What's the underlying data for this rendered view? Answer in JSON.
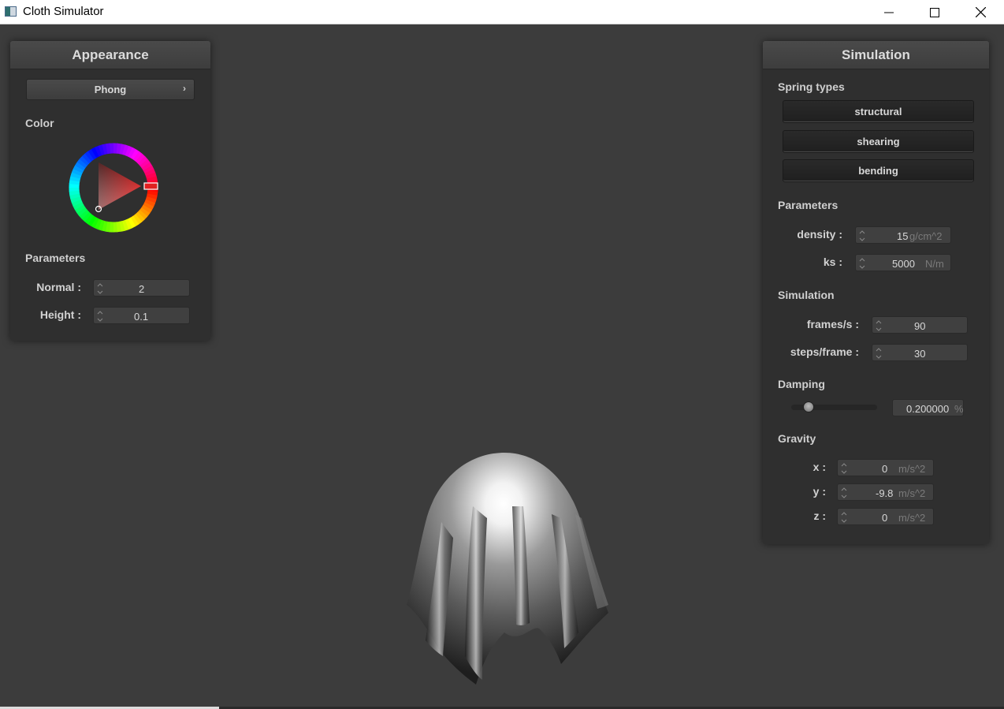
{
  "window": {
    "title": "Cloth Simulator"
  },
  "appearance": {
    "title": "Appearance",
    "shader_label": "Phong",
    "color_label": "Color",
    "parameters_label": "Parameters",
    "normal_label": "Normal :",
    "normal_value": "2",
    "height_label": "Height :",
    "height_value": "0.1",
    "selected_color": "#e02020"
  },
  "simulation": {
    "title": "Simulation",
    "spring_types_label": "Spring types",
    "springs": [
      "structural",
      "shearing",
      "bending"
    ],
    "parameters_label": "Parameters",
    "density_label": "density :",
    "density_value": "15",
    "density_unit": "g/cm^2",
    "ks_label": "ks :",
    "ks_value": "5000",
    "ks_unit": "N/m",
    "simulation_label": "Simulation",
    "fps_label": "frames/s :",
    "fps_value": "90",
    "steps_label": "steps/frame :",
    "steps_value": "30",
    "damping_label": "Damping",
    "damping_value": "0.200000",
    "damping_unit": "%",
    "damping_fraction": 0.2,
    "gravity_label": "Gravity",
    "gx_label": "x :",
    "gx_value": "0",
    "gy_label": "y :",
    "gy_value": "-9.8",
    "gz_label": "z :",
    "gz_value": "0",
    "gravity_unit": "m/s^2"
  }
}
